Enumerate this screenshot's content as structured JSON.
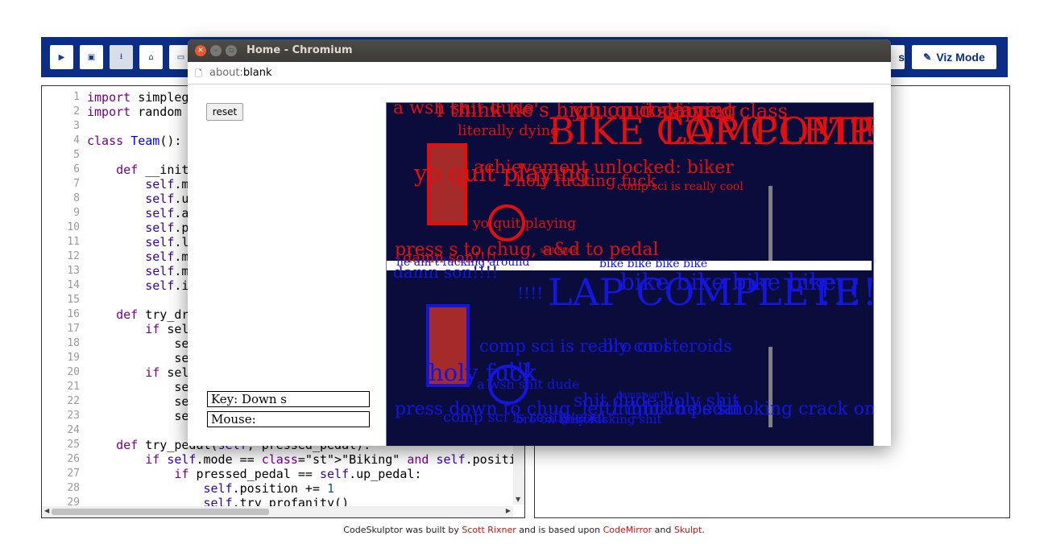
{
  "toolbar": {
    "buttons": [
      {
        "icon": "play-icon",
        "glyph": "▶"
      },
      {
        "icon": "save-icon",
        "glyph": "▣"
      },
      {
        "icon": "download-icon",
        "glyph": "⭳"
      },
      {
        "icon": "archive-icon",
        "glyph": "⌂"
      },
      {
        "icon": "folder-icon",
        "glyph": "▭"
      }
    ],
    "partial_button_text": "s",
    "viz_mode_label": "Viz Mode"
  },
  "editor": {
    "line_numbers": [
      "1",
      "2",
      "3",
      "4",
      "5",
      "6",
      "7",
      "8",
      "9",
      "10",
      "11",
      "12",
      "13",
      "14",
      "15",
      "16",
      "17",
      "18",
      "19",
      "20",
      "21",
      "22",
      "23",
      "24",
      "25",
      "26",
      "27",
      "28",
      "29"
    ],
    "lines": [
      "import simpleg",
      "import random",
      "",
      "class Team():",
      "",
      "    def __init",
      "        self.m",
      "        self.u",
      "        self.a",
      "        self.p",
      "        self.l",
      "        self.m",
      "        self.m",
      "        self.i",
      "",
      "    def try_dr",
      "        if sel",
      "            se",
      "            se",
      "        if sel",
      "            se",
      "            se",
      "            se",
      "",
      "    def try_pedal(self, pressed_pedal):",
      "        if self.mode == \"Biking\" and self.position < 30:",
      "            if pressed_pedal == self.up_pedal:",
      "                self.position += 1",
      "                self.try_profanity()"
    ]
  },
  "footer": {
    "prefix": "CodeSkulptor was built by ",
    "author": "Scott Rixner",
    "middle": " and is based upon ",
    "lib1": "CodeMirror",
    "and": " and ",
    "lib2": "Skulpt",
    "suffix": "."
  },
  "popup": {
    "title": "Home - Chromium",
    "url_scheme": "about:",
    "url_path": "blank",
    "reset_label": "reset",
    "key_label": "Key: Down s",
    "mouse_label": "Mouse:"
  },
  "canvas": {
    "background": "#0a0d3b",
    "red": "#e40e0e",
    "blue": "#1515e0",
    "red_texts": [
      "a wsh shit dude",
      "i think he's high on cocaine",
      "you quit playing",
      "i skipped class",
      "literally dying",
      "BIKE COMPLETE",
      "LAP COMPLETE",
      "!!!!",
      "achievement unlocked: biker",
      "yo quit playing",
      "holy fucking fuck",
      "comp sci is really cool",
      "yo quit playing",
      "press s to chug, a&d to pedal",
      "damn son!!!!",
      "shit dude"
    ],
    "blue_texts": [
      "he ain't fucking around",
      "damn son!!!!",
      "bike bike bike bike",
      "!!!!",
      "LAP COMPLETE",
      "bike bike bike bike",
      "!!!!",
      "comp sci is really cool",
      "bro on steroids",
      "holy fuck",
      "!!!",
      "a wsh shit dude",
      "shit dude holy shit",
      "damn son!!!!",
      "press down to chug, left/right to pedal",
      "i think he's smoking crack on the",
      "comp sci is really cool",
      "bro on steroids",
      "holy fucking shit"
    ]
  }
}
